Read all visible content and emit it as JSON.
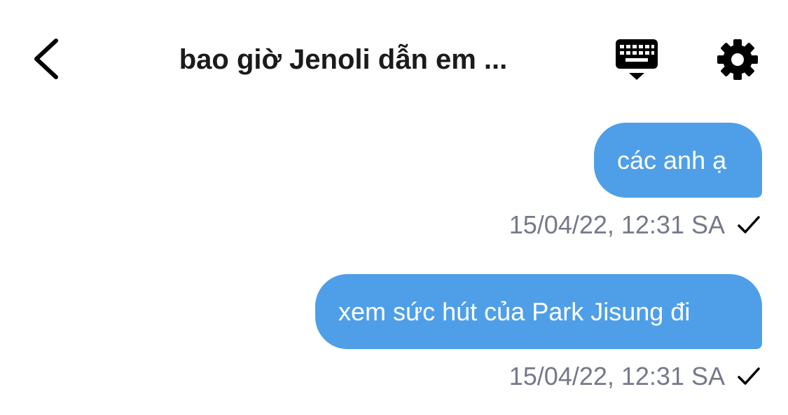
{
  "header": {
    "title": "bao giờ Jenoli dẫn em ...",
    "back_icon": "chevron-left-icon",
    "keyboard_icon": "keyboard-icon",
    "settings_icon": "gear-icon"
  },
  "messages": [
    {
      "text": "các anh ạ",
      "timestamp": "15/04/22, 12:31 SA",
      "status_icon": "checkmark-icon"
    },
    {
      "text": "xem sức hút của Park Jisung đi",
      "timestamp": "15/04/22, 12:31 SA",
      "status_icon": "checkmark-icon"
    }
  ],
  "colors": {
    "bubble": "#4f9fe8",
    "bubble_text": "#ffffff",
    "timestamp": "#74798a",
    "title": "#1b1b1b",
    "icon": "#000000"
  }
}
